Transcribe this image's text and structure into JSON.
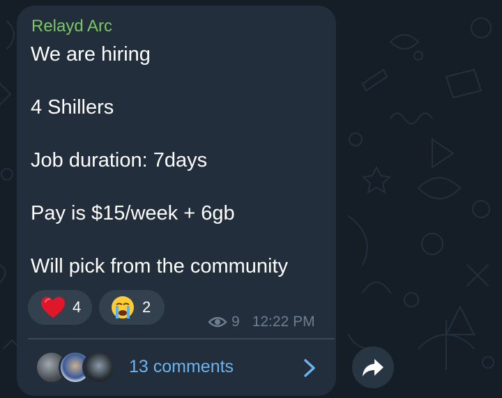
{
  "colors": {
    "background": "#151e27",
    "bubble": "#222e3b",
    "sender": "#7bc862",
    "link": "#6cb4ef",
    "meta": "#6d7f8f"
  },
  "message": {
    "sender": "Relayd Arc",
    "lines": [
      "We are hiring",
      "4 Shillers",
      "Job duration: 7days",
      "Pay is $15/week + 6gb",
      "Will pick from the community"
    ]
  },
  "reactions": [
    {
      "emoji": "❤️",
      "icon": "heart-icon",
      "count": "4"
    },
    {
      "emoji": "😭",
      "icon": "crying-face-icon",
      "count": "2"
    }
  ],
  "meta": {
    "views": "9",
    "time": "12:22 PM"
  },
  "comments": {
    "label": "13 comments"
  },
  "icons": {
    "views": "eye-icon",
    "chevron": "chevron-right-icon",
    "share": "share-arrow-icon"
  }
}
